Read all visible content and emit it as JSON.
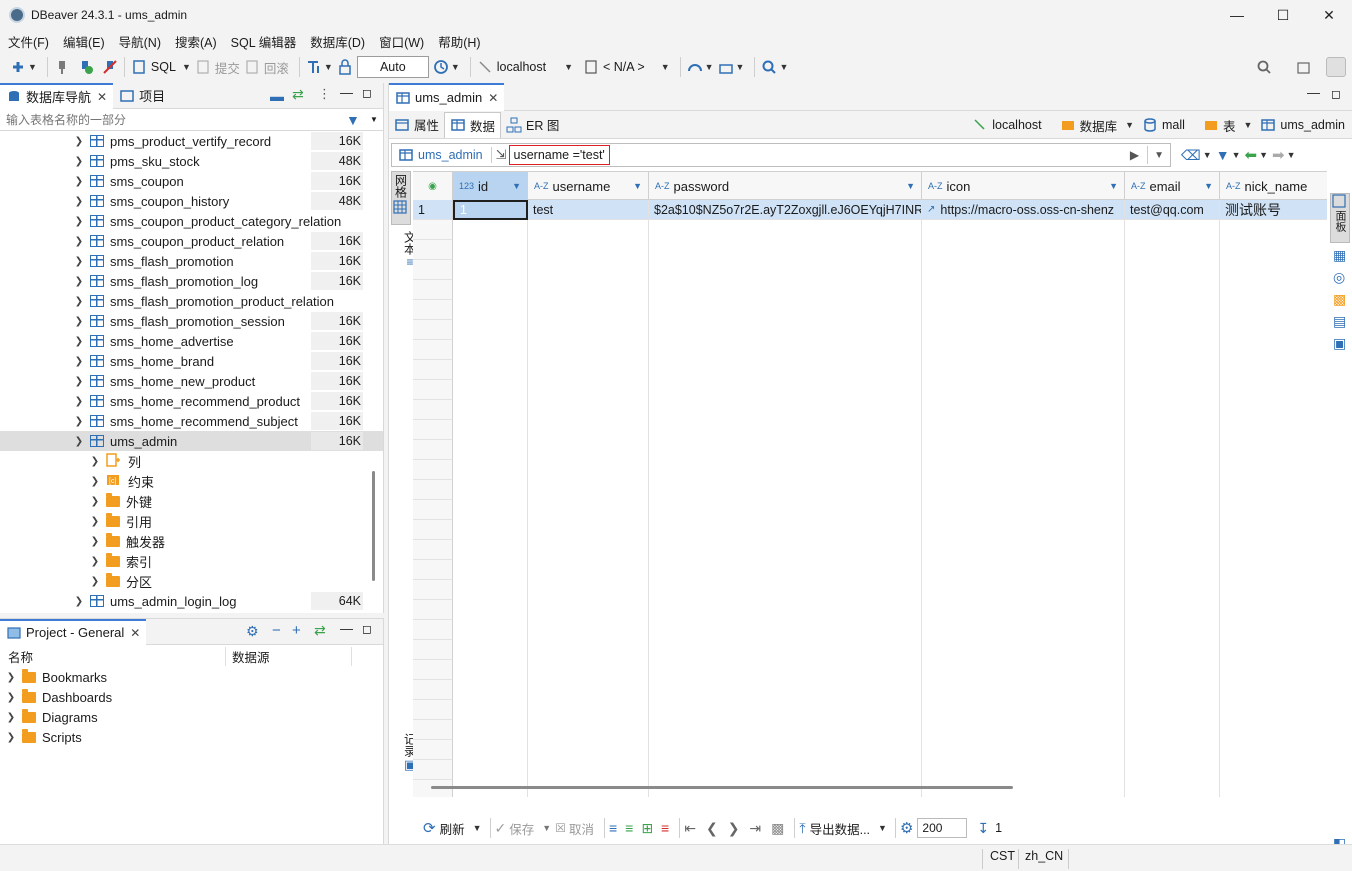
{
  "window": {
    "title": "DBeaver 24.3.1 - ums_admin"
  },
  "menu": [
    "文件(F)",
    "编辑(E)",
    "导航(N)",
    "搜索(A)",
    "SQL 编辑器",
    "数据库(D)",
    "窗口(W)",
    "帮助(H)"
  ],
  "toolbar": {
    "sql_label": "SQL",
    "commit_label": "提交",
    "rollback_label": "回滚",
    "auto_label": "Auto",
    "connection_label": "localhost",
    "schema_label": "< N/A >"
  },
  "navigator": {
    "tab_label": "数据库导航",
    "project_tab_label": "项目",
    "filter_placeholder": "输入表格名称的一部分",
    "tables": [
      {
        "name": "pms_product_vertify_record",
        "size": "16K"
      },
      {
        "name": "pms_sku_stock",
        "size": "48K"
      },
      {
        "name": "sms_coupon",
        "size": "16K"
      },
      {
        "name": "sms_coupon_history",
        "size": "48K"
      },
      {
        "name": "sms_coupon_product_category_relation",
        "size": ""
      },
      {
        "name": "sms_coupon_product_relation",
        "size": "16K"
      },
      {
        "name": "sms_flash_promotion",
        "size": "16K"
      },
      {
        "name": "sms_flash_promotion_log",
        "size": "16K"
      },
      {
        "name": "sms_flash_promotion_product_relation",
        "size": ""
      },
      {
        "name": "sms_flash_promotion_session",
        "size": "16K"
      },
      {
        "name": "sms_home_advertise",
        "size": "16K"
      },
      {
        "name": "sms_home_brand",
        "size": "16K"
      },
      {
        "name": "sms_home_new_product",
        "size": "16K"
      },
      {
        "name": "sms_home_recommend_product",
        "size": "16K"
      },
      {
        "name": "sms_home_recommend_subject",
        "size": "16K"
      },
      {
        "name": "ums_admin",
        "size": "16K"
      }
    ],
    "children": [
      "列",
      "约束",
      "外键",
      "引用",
      "触发器",
      "索引",
      "分区"
    ],
    "after_table": {
      "name": "ums_admin_login_log",
      "size": "64K"
    }
  },
  "project": {
    "tab_label": "Project - General",
    "col_name": "名称",
    "col_datasource": "数据源",
    "items": [
      "Bookmarks",
      "Dashboards",
      "Diagrams",
      "Scripts"
    ]
  },
  "editor": {
    "tab_label": "ums_admin",
    "subtabs": [
      "属性",
      "数据",
      "ER 图"
    ],
    "crumbs": {
      "connection": "localhost",
      "database_label": "数据库",
      "database": "mall",
      "table_label": "表",
      "table": "ums_admin"
    },
    "filter_table": "ums_admin",
    "filter_text": "username ='test'",
    "side_labels": {
      "grid": "网格",
      "text": "文本",
      "record": "记录"
    },
    "columns": [
      {
        "type": "123",
        "name": "id"
      },
      {
        "type": "A-Z",
        "name": "username"
      },
      {
        "type": "A-Z",
        "name": "password"
      },
      {
        "type": "A-Z",
        "name": "icon"
      },
      {
        "type": "A-Z",
        "name": "email"
      },
      {
        "type": "A-Z",
        "name": "nick_name"
      }
    ],
    "rows": [
      {
        "num": "1",
        "id": "1",
        "username": "test",
        "password": "$2a$10$NZ5o7r2E.ayT2Zoxgjll.eJ6OEYqjH7INR",
        "icon": "https://macro-oss.oss-cn-shenz",
        "email": "test@qq.com",
        "nick_name": "测试账号"
      }
    ],
    "bottom": {
      "refresh": "刷新",
      "save": "保存",
      "cancel": "取消",
      "export": "导出数据...",
      "fetch_size": "200",
      "row_count": "1"
    },
    "right_label": "面板"
  },
  "status": {
    "timezone": "CST",
    "locale": "zh_CN"
  },
  "colors": {
    "accent": "#3d7bd6",
    "folder": "#f29d1f",
    "filter_border": "#e02020",
    "selected_cell": "#b9d4f1"
  }
}
